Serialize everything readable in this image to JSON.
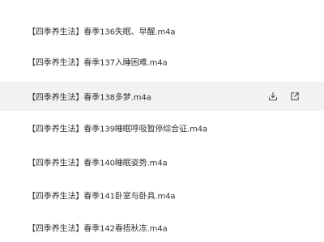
{
  "files": [
    {
      "name": "【四季养生法】春季136失眠、早醒.m4a"
    },
    {
      "name": "【四季养生法】春季137入睡困难.m4a"
    },
    {
      "name": "【四季养生法】春季138多梦.m4a"
    },
    {
      "name": "【四季养生法】春季139睡眠呼吸暂停综合征.m4a"
    },
    {
      "name": "【四季养生法】春季140睡眠姿势.m4a"
    },
    {
      "name": "【四季养生法】春季141卧室与卧具.m4a"
    },
    {
      "name": "【四季养生法】春季142春捂秋冻.m4a"
    }
  ],
  "hovered_row_actions": {
    "download_icon": "download-icon",
    "share_icon": "external-link-icon"
  },
  "colors": {
    "hover_background": "#f2f2f2",
    "text": "#333333",
    "icon": "#555555"
  }
}
